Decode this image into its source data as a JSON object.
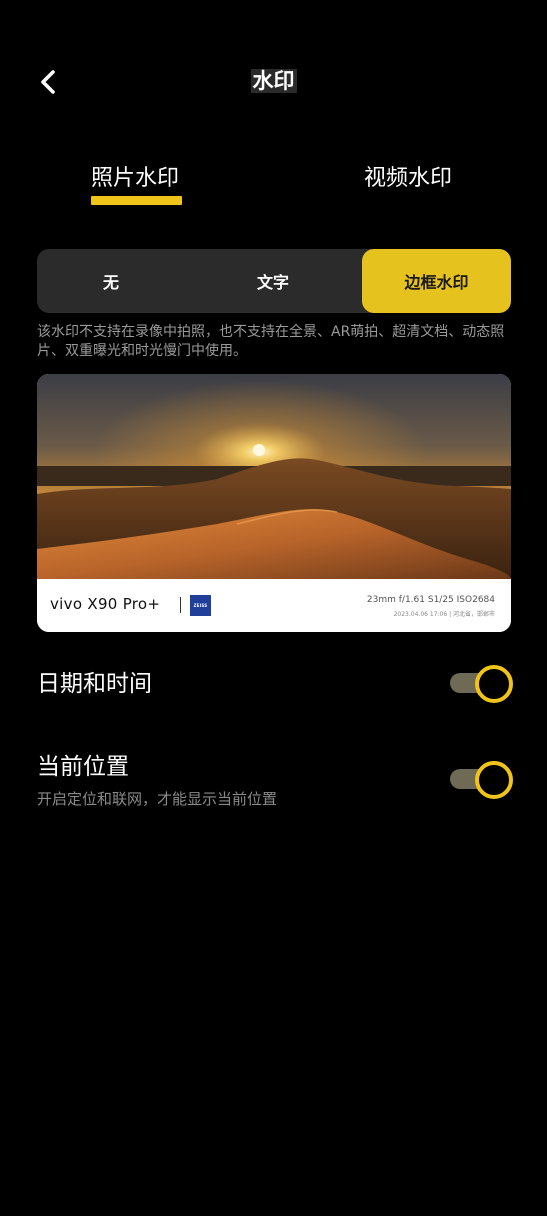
{
  "header": {
    "title": "水印",
    "back_icon": "chevron-left-icon"
  },
  "tabs": [
    {
      "label": "照片水印",
      "active": true
    },
    {
      "label": "视频水印",
      "active": false
    }
  ],
  "segments": [
    {
      "label": "无",
      "selected": false
    },
    {
      "label": "文字",
      "selected": false
    },
    {
      "label": "边框水印",
      "selected": true
    }
  ],
  "notice": "该水印不支持在录像中拍照，也不支持在全景、AR萌拍、超清文档、动态照片、双重曝光和时光慢门中使用。",
  "preview": {
    "model": "vivo X90 Pro+",
    "logo_text": "ZEISS",
    "params": "23mm f/1.61 S1/25 ISO2684",
    "meta": "2023.04.06 17:06 | 河北省，邯郸市"
  },
  "settings": [
    {
      "label": "日期和时间",
      "sub": "",
      "enabled": true
    },
    {
      "label": "当前位置",
      "sub": "开启定位和联网，才能显示当前位置",
      "enabled": true
    }
  ],
  "colors": {
    "accent": "#f0c419",
    "segment_selected": "#e6c21e",
    "background": "#000000",
    "segment_bg": "#2b2b2b",
    "toggle_track": "#6e6a55"
  }
}
